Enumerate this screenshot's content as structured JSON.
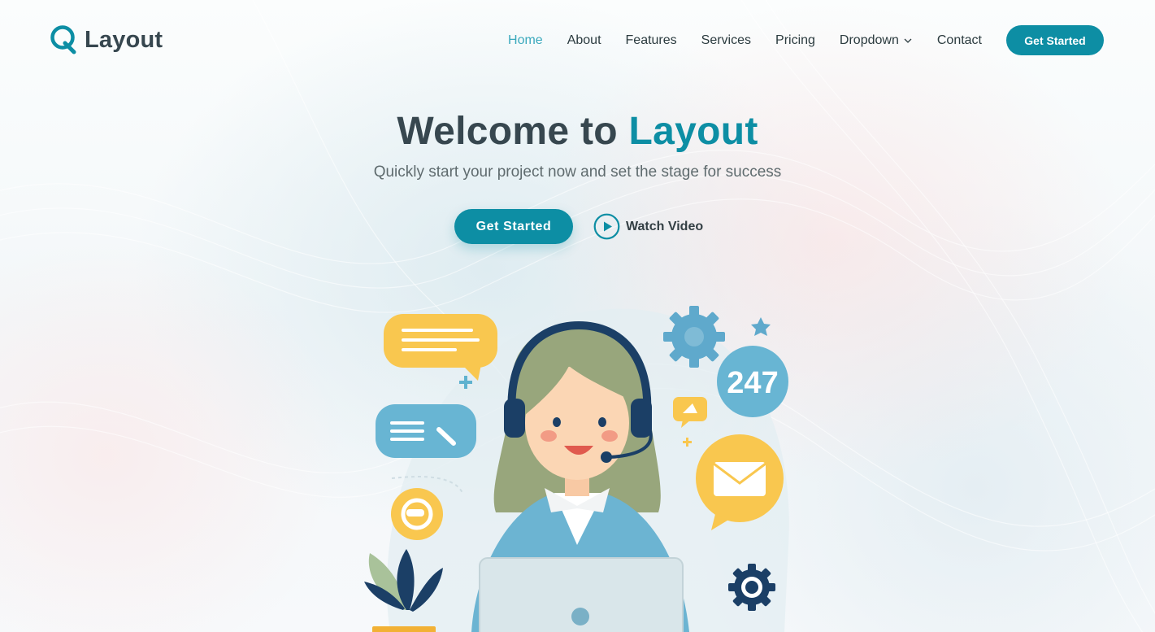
{
  "brand": {
    "name": "Layout",
    "accent_color": "#0d8ea4",
    "logo_icon": "q-logo-icon"
  },
  "nav": {
    "items": [
      {
        "label": "Home",
        "active": true
      },
      {
        "label": "About"
      },
      {
        "label": "Features"
      },
      {
        "label": "Services"
      },
      {
        "label": "Pricing"
      },
      {
        "label": "Dropdown",
        "icon": "chevron-down-icon"
      },
      {
        "label": "Contact"
      }
    ],
    "cta_label": "Get Started",
    "active_color": "#3ba9bd"
  },
  "hero": {
    "title_prefix": "Welcome to ",
    "title_accent": "Layout",
    "subtitle": "Quickly start your project now and set the stage for success",
    "primary_cta_label": "Get Started",
    "video_label": "Watch Video",
    "video_icon": "play-circle-icon"
  },
  "illustration": {
    "badge_text": "247",
    "subject": "customer-support-agent-illustration"
  }
}
